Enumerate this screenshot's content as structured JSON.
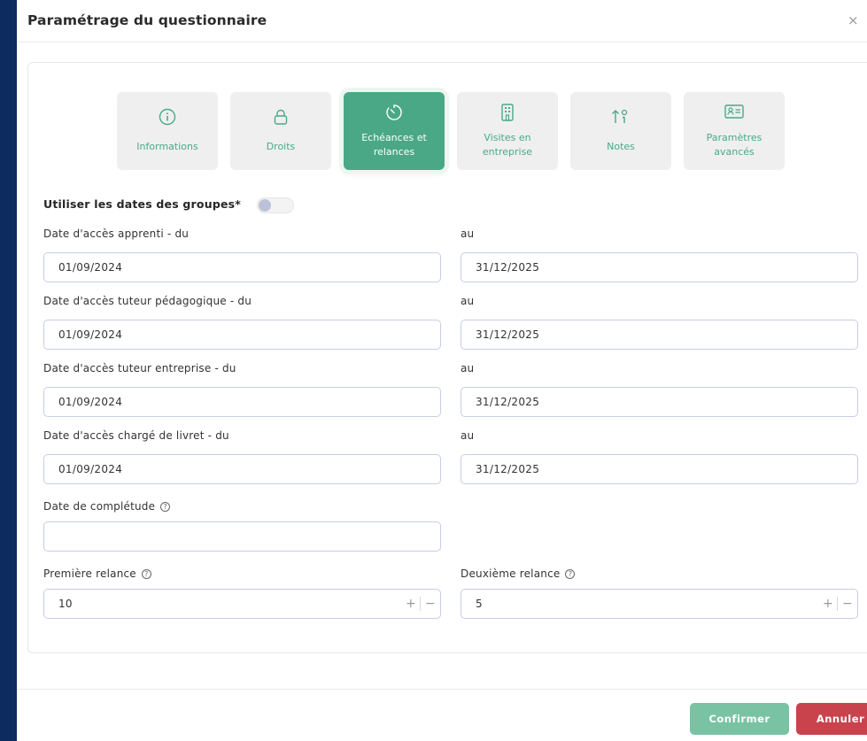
{
  "modal": {
    "title": "Paramétrage du questionnaire",
    "close_glyph": "×"
  },
  "tabs": [
    {
      "label_line1": "Informations",
      "label_line2": "",
      "icon": "info-icon"
    },
    {
      "label_line1": "Droits",
      "label_line2": "",
      "icon": "lock-icon"
    },
    {
      "label_line1": "Echéances et",
      "label_line2": "relances",
      "icon": "timer-icon",
      "active": true
    },
    {
      "label_line1": "Visites en",
      "label_line2": "entreprise",
      "icon": "building-icon"
    },
    {
      "label_line1": "Notes",
      "label_line2": "",
      "icon": "sort-notes-icon"
    },
    {
      "label_line1": "Paramètres",
      "label_line2": "avancés",
      "icon": "id-card-icon"
    }
  ],
  "group_dates": {
    "label": "Utiliser les dates des groupes*",
    "enabled": false
  },
  "access_rows": [
    {
      "from_label": "Date d'accès apprenti - du",
      "to_label": "au",
      "from_value": "01/09/2024",
      "to_value": "31/12/2025"
    },
    {
      "from_label": "Date d'accès tuteur pédagogique - du",
      "to_label": "au",
      "from_value": "01/09/2024",
      "to_value": "31/12/2025"
    },
    {
      "from_label": "Date d'accès tuteur entreprise - du",
      "to_label": "au",
      "from_value": "01/09/2024",
      "to_value": "31/12/2025"
    },
    {
      "from_label": "Date d'accès chargé de livret - du",
      "to_label": "au",
      "from_value": "01/09/2024",
      "to_value": "31/12/2025"
    }
  ],
  "completion": {
    "label": "Date de complétude",
    "value": ""
  },
  "reminders": {
    "first": {
      "label": "Première relance",
      "value": "10"
    },
    "second": {
      "label": "Deuxième relance",
      "value": "5"
    },
    "plus": "+",
    "minus": "−"
  },
  "help_glyph": "?",
  "footer": {
    "confirm_label": "Confirmer",
    "cancel_label": "Annuler"
  },
  "colors": {
    "accent": "#4aa886",
    "confirm": "#79c3a4",
    "cancel": "#c9434d",
    "backdrop": "#0d2b5e"
  }
}
